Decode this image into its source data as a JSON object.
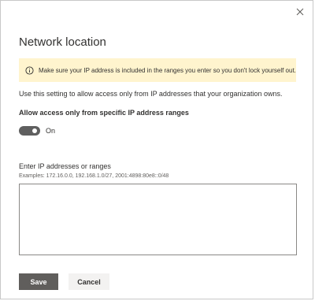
{
  "dialog": {
    "title": "Network location",
    "notice": {
      "icon": "info-icon",
      "text": "Make sure your IP address is included in the ranges you enter so you don't lock yourself out.",
      "background_color": "#fff4ce"
    },
    "description": "Use this setting to allow access only from IP addresses that your organization owns.",
    "toggle": {
      "label": "Allow access only from specific IP address ranges",
      "state_text": "On",
      "checked": true,
      "color": "#5f5f5f"
    },
    "ip_field": {
      "label": "Enter IP addresses or ranges",
      "examples": "Examples: 172.16.0.0, 192.168.1.0/27, 2001:4898:80e8::0/48",
      "value": ""
    },
    "buttons": {
      "save_label": "Save",
      "cancel_label": "Cancel",
      "save_color": "#605e5c"
    },
    "close_icon": "close-icon"
  }
}
